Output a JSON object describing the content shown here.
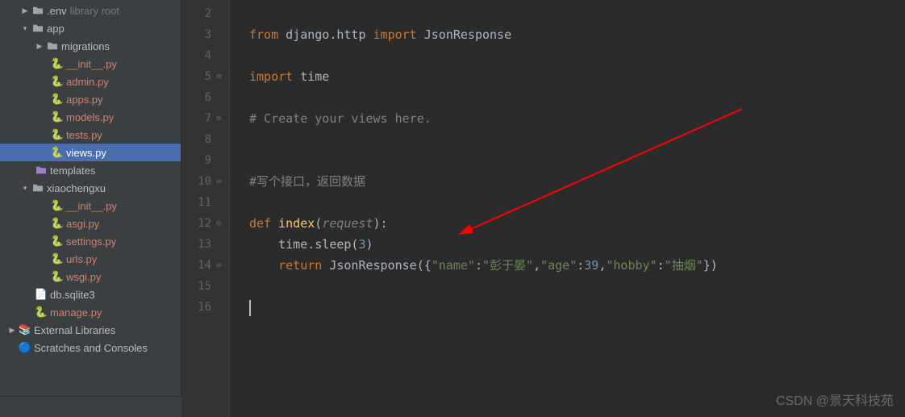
{
  "tree": {
    "env": ".env",
    "lib": "library root",
    "app": "app",
    "migrations": "migrations",
    "init": "__init__.py",
    "admin": "admin.py",
    "apps": "apps.py",
    "models": "models.py",
    "tests": "tests.py",
    "views": "views.py",
    "templates": "templates",
    "xiaochengxu": "xiaochengxu",
    "init2": "__init__.py",
    "asgi": "asgi.py",
    "settings": "settings.py",
    "urls": "urls.py",
    "wsgi": "wsgi.py",
    "db": "db.sqlite3",
    "manage": "manage.py",
    "external": "External Libraries",
    "scratches": "Scratches and Consoles"
  },
  "lines": {
    "start": 2,
    "end": 16
  },
  "code": {
    "l3_from": "from ",
    "l3_module": "django.http ",
    "l3_import": "import ",
    "l3_name": "JsonResponse",
    "l5_import": "import ",
    "l5_time": "time",
    "l7_comment": "# Create your views here.",
    "l10_comment": "#写个接口，返回数据",
    "l12_def": "def ",
    "l12_name": "index",
    "l12_paren1": "(",
    "l12_param": "request",
    "l12_paren2": "):",
    "l13_indent": "    ",
    "l13_time": "time.sleep(",
    "l13_num": "3",
    "l13_close": ")",
    "l14_indent": "    ",
    "l14_return": "return ",
    "l14_call": "JsonResponse({",
    "l14_k1": "\"name\"",
    "l14_c1": ":",
    "l14_v1": "\"彭于晏\"",
    "l14_c2": ",",
    "l14_k2": "\"age\"",
    "l14_c3": ":",
    "l14_v2": "39",
    "l14_c4": ",",
    "l14_k3": "\"hobby\"",
    "l14_c5": ":",
    "l14_v3": "\"抽烟\"",
    "l14_end": "})"
  },
  "watermark": "CSDN @景天科技苑"
}
